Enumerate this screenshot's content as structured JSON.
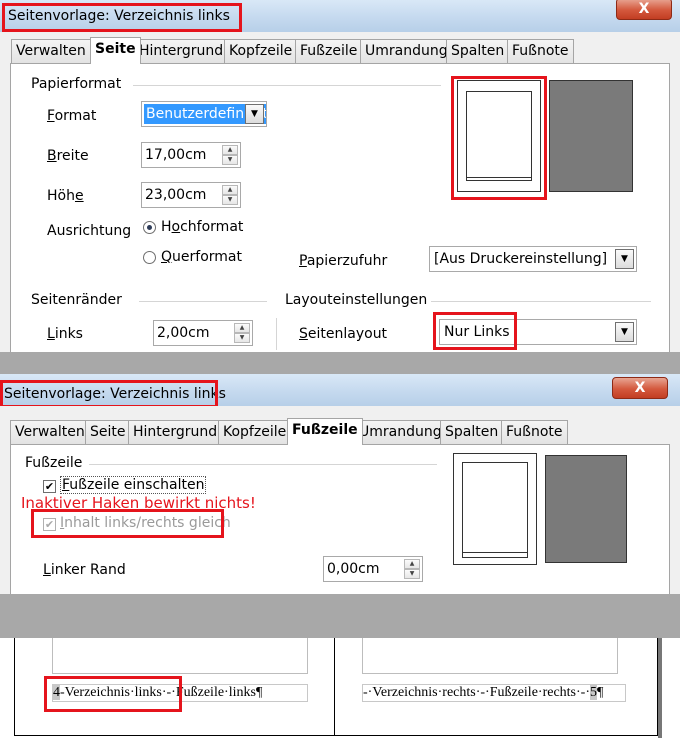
{
  "dialog1": {
    "title": "Seitenvorlage: Verzeichnis links",
    "close_label": "X",
    "tabs": [
      "Verwalten",
      "Seite",
      "Hintergrund",
      "Kopfzeile",
      "Fußzeile",
      "Umrandung",
      "Spalten",
      "Fußnote"
    ],
    "active_tab": "Seite",
    "paper_group": "Papierformat",
    "format_label": "Format",
    "format_value": "Benutzerdefiniert",
    "width_label": "Breite",
    "width_value": "17,00cm",
    "height_label": "Höhe",
    "height_value": "23,00cm",
    "orientation_label": "Ausrichtung",
    "portrait_label": "Hochformat",
    "landscape_label": "Querformat",
    "orientation_selected": "Hochformat",
    "paper_tray_label": "Papierzufuhr",
    "paper_tray_value": "[Aus Druckereinstellung]",
    "margins_group": "Seitenränder",
    "layout_group": "Layouteinstellungen",
    "left_margin_label": "Links",
    "left_margin_value": "2,00cm",
    "page_layout_label": "Seitenlayout",
    "page_layout_value": "Nur Links"
  },
  "dialog2": {
    "title": "Seitenvorlage: Verzeichnis links",
    "close_label": "X",
    "tabs": [
      "Verwalten",
      "Seite",
      "Hintergrund",
      "Kopfzeile",
      "Fußzeile",
      "Umrandung",
      "Spalten",
      "Fußnote"
    ],
    "active_tab": "Fußzeile",
    "footer_group": "Fußzeile",
    "footer_on_label": "Fußzeile einschalten",
    "footer_on_checked": true,
    "annotation": "Inaktiver Haken bewirkt nichts!",
    "same_content_label": "Inhalt links/rechts gleich",
    "same_content_checked": true,
    "left_margin_label": "Linker Rand",
    "left_margin_value": "0,00cm"
  },
  "document": {
    "left_footer_number": "4",
    "left_footer_text": "-Verzeichnis·links·-·Fußzeile·links¶",
    "right_footer_text": "-·Verzeichnis·rechts·-·Fußzeile·rechts·-·",
    "right_footer_number": "5",
    "right_footer_pilcrow": "¶"
  },
  "colors": {
    "highlight": "#e5141c",
    "annotation_text": "#e5141c"
  }
}
